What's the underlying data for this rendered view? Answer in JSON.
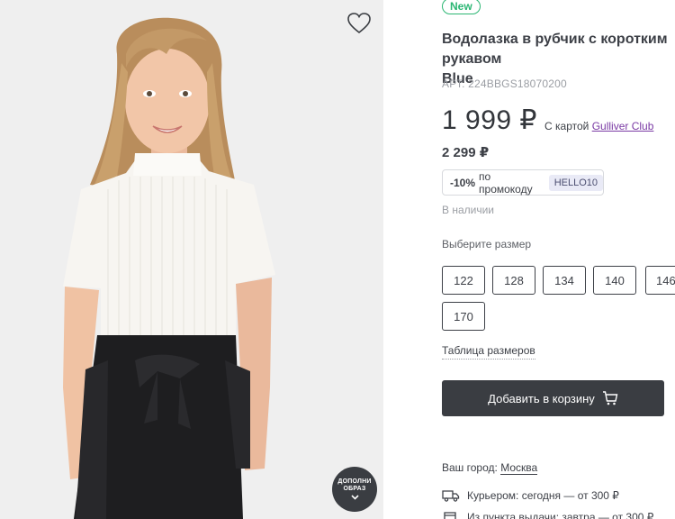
{
  "product": {
    "badge": "New",
    "title": "Водолазка в рубчик с коротким рукавом\nBlue",
    "article": "АРТ. 224BBGS18070200",
    "price": "1 999 ₽",
    "club_prefix": "С картой",
    "club_link": "Gulliver Club",
    "old_price": "2 299 ₽",
    "promo": {
      "discount": "-10%",
      "text": "по промокоду",
      "code": "HELLO10"
    },
    "stock": "В наличии"
  },
  "sizes": {
    "label": "Выберите размер",
    "options": [
      "122",
      "128",
      "134",
      "140",
      "146",
      "170"
    ],
    "table_link": "Таблица размеров"
  },
  "cart": {
    "add_label": "Добавить в корзину"
  },
  "delivery": {
    "city_prefix": "Ваш город:",
    "city": "Москва",
    "options": [
      "Курьером: сегодня — от 300 ₽",
      "Из пункта выдачи: завтра — от 300 ₽"
    ]
  },
  "photo": {
    "outfit_line1": "ДОПОЛНИ",
    "outfit_line2": "ОБРАЗ"
  },
  "icons": [
    "heart-icon",
    "chevron-down-icon",
    "cart-icon",
    "truck-icon",
    "box-icon"
  ],
  "colors": {
    "accent_new": "#2bb673",
    "club": "#7a3aa4",
    "button": "#3a3d42"
  }
}
